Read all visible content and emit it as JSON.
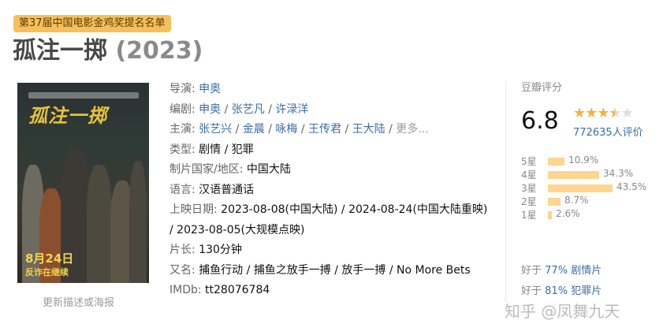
{
  "award": {
    "text": "第37届中国电影金鸡奖提名名单"
  },
  "movie": {
    "title": "孤注一掷",
    "year": "(2023)",
    "poster": {
      "title_art": "孤注一掷",
      "release_date": "8月24日",
      "release_sub": "反诈在继续"
    },
    "update_link": "更新描述或海报",
    "info": {
      "director": {
        "label": "导演:",
        "names": [
          "申奥"
        ]
      },
      "writers": {
        "label": "编剧:",
        "names": [
          "申奥",
          "张艺凡",
          "许渌洋"
        ]
      },
      "cast": {
        "label": "主演:",
        "names": [
          "张艺兴",
          "金晨",
          "咏梅",
          "王传君",
          "王大陆"
        ],
        "more": "更多..."
      },
      "genre": {
        "label": "类型:",
        "value": "剧情 / 犯罪"
      },
      "country": {
        "label": "制片国家/地区:",
        "value": "中国大陆"
      },
      "language": {
        "label": "语言:",
        "value": "汉语普通话"
      },
      "release": {
        "label": "上映日期:",
        "value": "2023-08-08(中国大陆) / 2024-08-24(中国大陆重映) / 2023-08-05(大规模点映)"
      },
      "runtime": {
        "label": "片长:",
        "value": "130分钟"
      },
      "aka": {
        "label": "又名:",
        "value": "捕鱼行动 / 捕鱼之放手一搏 / 放手一搏 / No More Bets"
      },
      "imdb": {
        "label": "IMDb:",
        "value": "tt28076784"
      }
    }
  },
  "rating": {
    "heading": "豆瓣评分",
    "score": "6.8",
    "stars_value": 3.5,
    "votes": "772635人评价",
    "distribution": [
      {
        "label": "5星",
        "percent": "10.9%",
        "value": 10.9
      },
      {
        "label": "4星",
        "percent": "34.3%",
        "value": 34.3
      },
      {
        "label": "3星",
        "percent": "43.5%",
        "value": 43.5
      },
      {
        "label": "2星",
        "percent": "8.7%",
        "value": 8.7
      },
      {
        "label": "1星",
        "percent": "2.6%",
        "value": 2.6
      }
    ],
    "better_than": [
      {
        "prefix": "好于",
        "percent": "77%",
        "genre": "剧情片"
      },
      {
        "prefix": "好于",
        "percent": "81%",
        "genre": "犯罪片"
      }
    ]
  },
  "watermark": "知乎 @凤舞九天",
  "colors": {
    "link": "#3a6ea5",
    "badge": "#f5c05c",
    "bar": "#ffd58f",
    "star": "#f0b43c"
  }
}
